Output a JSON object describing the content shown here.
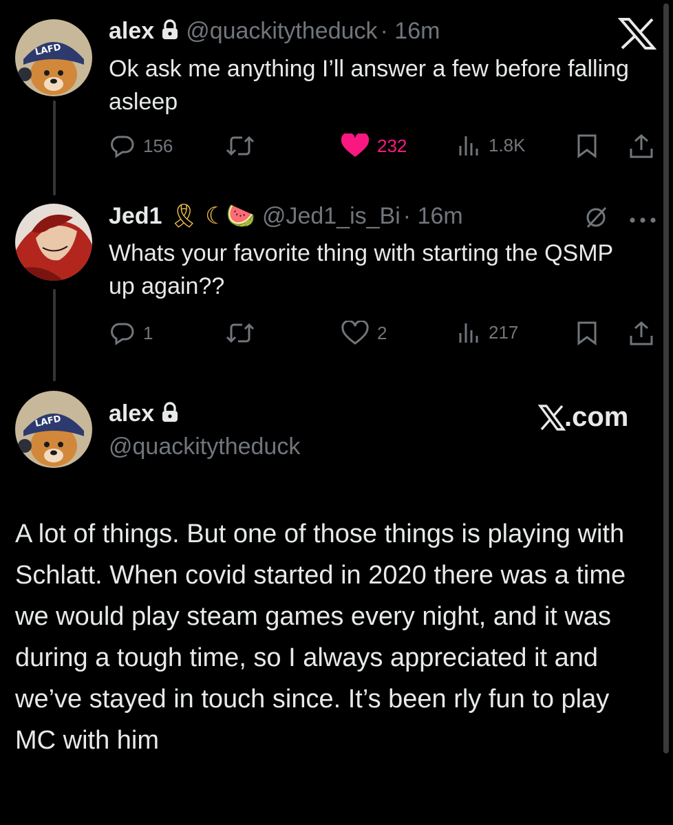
{
  "tweets": [
    {
      "name": "alex",
      "handle": "@quackitytheduck",
      "time": "· 16m",
      "text": "Ok ask me anything I’ll answer a few before falling asleep",
      "stats": {
        "replies": "156",
        "likes": "232",
        "views": "1.8K"
      },
      "liked": true
    },
    {
      "name": "Jed1",
      "badges": "🎗 ☾🍉",
      "handle": "@Jed1_is_Bi",
      "time": "· 16m",
      "text": "Whats your favorite thing with starting the QSMP up again??",
      "stats": {
        "replies": "1",
        "likes": "2",
        "views": "217"
      },
      "liked": false
    }
  ],
  "reply": {
    "name": "alex",
    "handle": "@quackitytheduck",
    "site": "X.com",
    "text": "A lot of things. But one of those things is playing with Schlatt. When covid started in 2020 there was a time we would play steam games every night, and it was during a tough time, so I always appreciated it and we’ve stayed in touch since. It’s been rly fun to play MC with him"
  },
  "colors": {
    "background": "#000000",
    "text": "#e7e9ea",
    "muted": "#71767b",
    "like": "#f91880"
  },
  "icons": [
    "x-logo-icon",
    "lock-icon",
    "reply-icon",
    "retweet-icon",
    "heart-icon",
    "views-icon",
    "bookmark-icon",
    "share-icon",
    "grok-icon",
    "more-icon"
  ]
}
